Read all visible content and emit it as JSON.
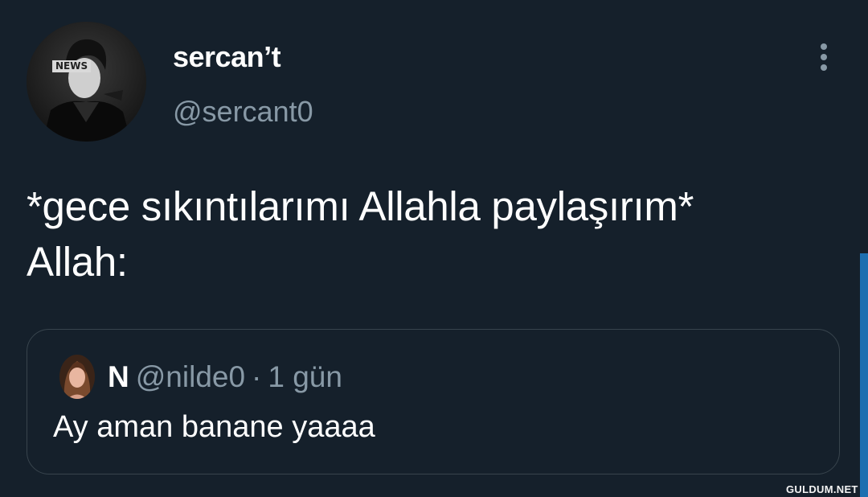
{
  "tweet": {
    "author_name": "sercan’t",
    "author_handle": "@sercant0",
    "avatar_badge": "NEWS",
    "text": "*gece sıkıntılarımı Allahla paylaşırım*\nAllah:"
  },
  "quoted_tweet": {
    "author_name": "N",
    "author_handle": "@nilde0",
    "separator": "·",
    "time": "1 gün",
    "text": "Ay aman banane yaaaa"
  },
  "watermark": "GULDUM.NET",
  "icons": {
    "more": "more-vertical-icon"
  },
  "colors": {
    "background": "#15202b",
    "primary_text": "#ffffff",
    "secondary_text": "#8899a6",
    "border": "#38444d",
    "scrollbar": "#1d6fb0"
  }
}
